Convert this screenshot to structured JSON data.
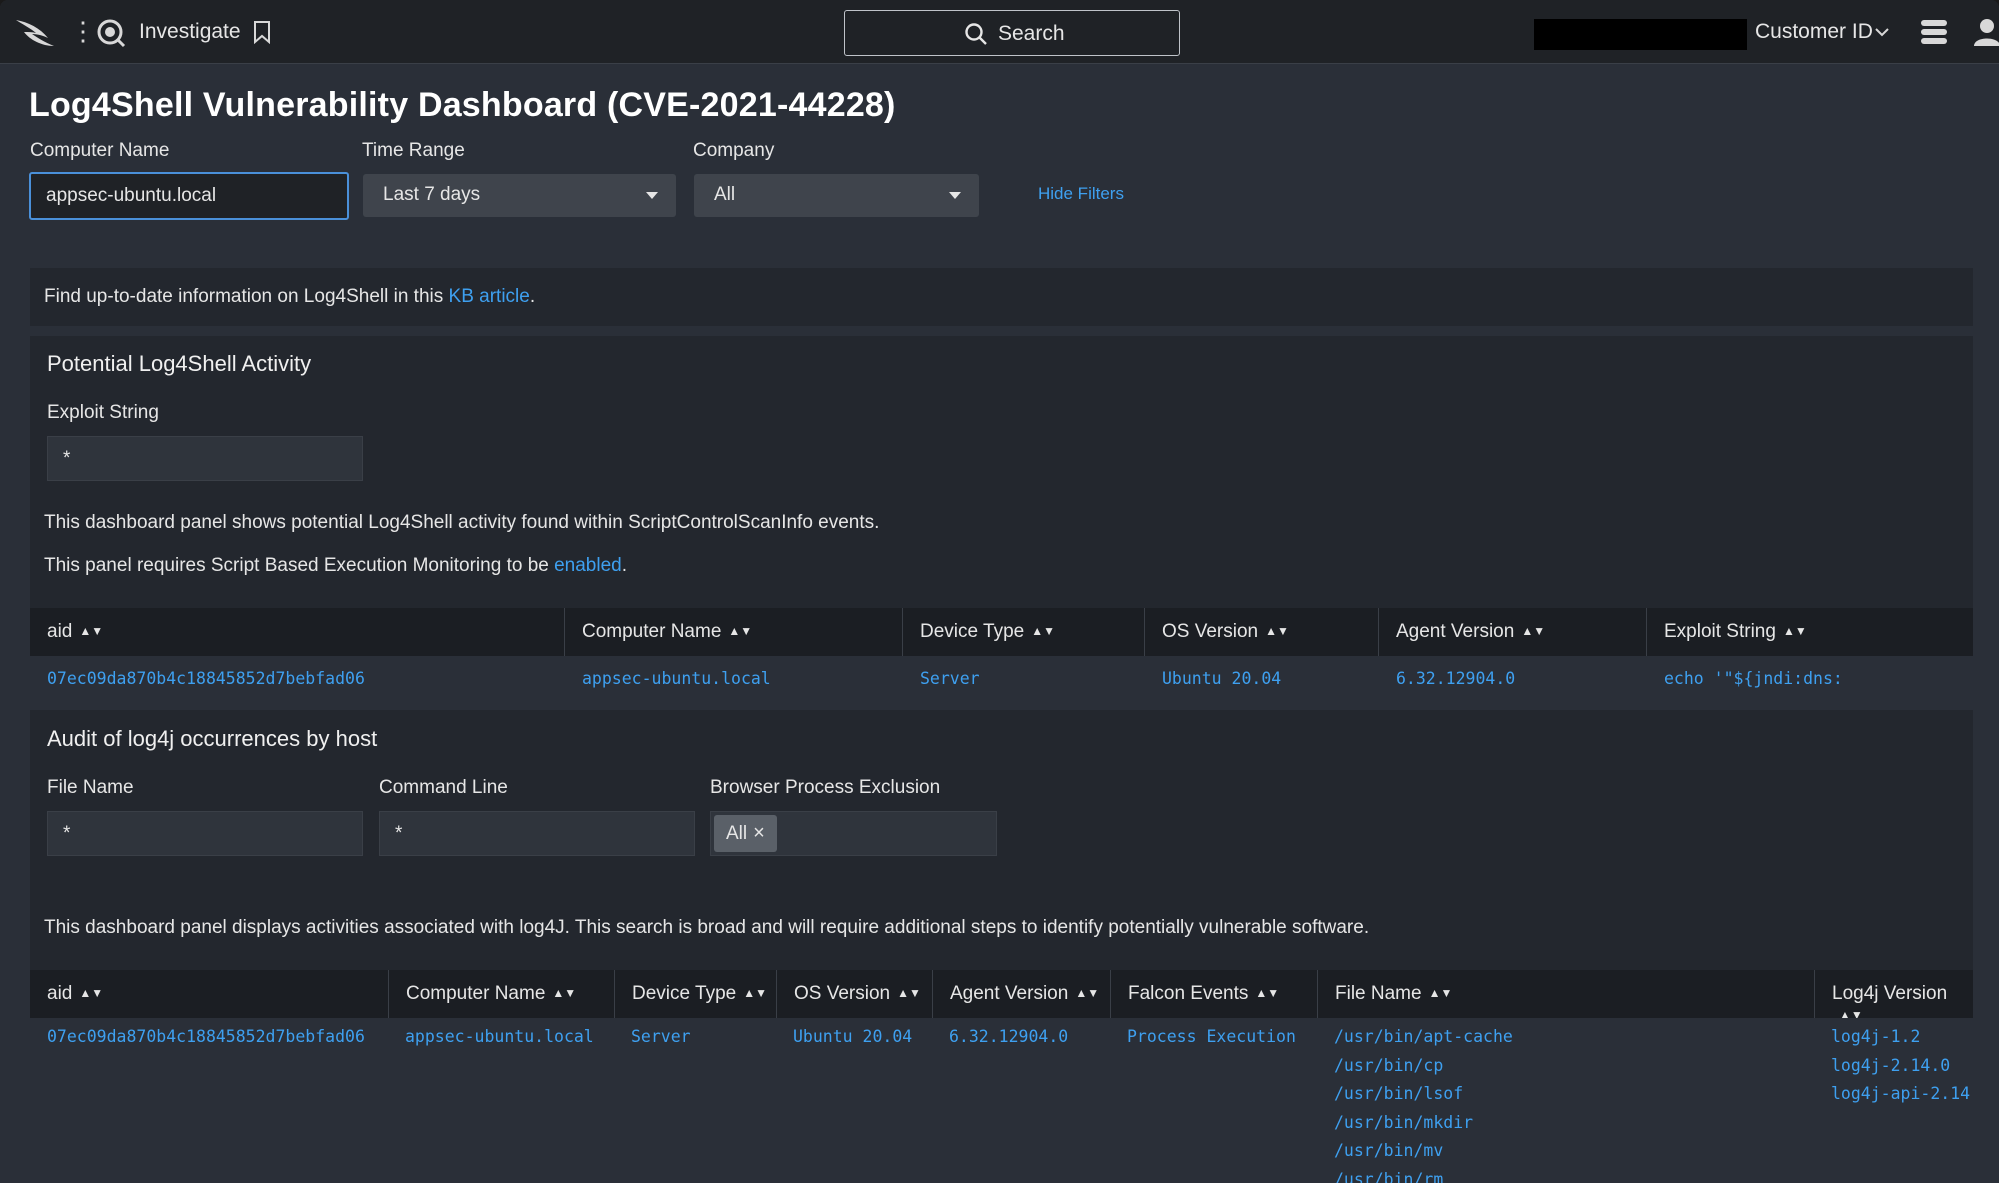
{
  "topbar": {
    "app_name": "Investigate",
    "search_label": "Search",
    "customer_id_label": "Customer ID"
  },
  "dashboard": {
    "title": "Log4Shell Vulnerability Dashboard (CVE-2021-44228)",
    "filters": {
      "computer_name_label": "Computer Name",
      "computer_name_value": "appsec-ubuntu.local",
      "time_range_label": "Time Range",
      "time_range_value": "Last 7 days",
      "company_label": "Company",
      "company_value": "All",
      "hide_filters": "Hide Filters"
    },
    "info": {
      "text_before": "Find up-to-date information on Log4Shell in this ",
      "link": "KB article",
      "text_after": "."
    },
    "activity_panel": {
      "title": "Potential Log4Shell Activity",
      "exploit_label": "Exploit String",
      "exploit_value": "*",
      "desc1": "This dashboard panel shows potential Log4Shell activity found within ScriptControlScanInfo events.",
      "desc2_before": "This panel requires Script Based Execution Monitoring to be ",
      "desc2_link": "enabled",
      "desc2_after": ".",
      "columns": [
        "aid",
        "Computer Name",
        "Device Type",
        "OS Version",
        "Agent Version",
        "Exploit String"
      ],
      "row": [
        "07ec09da870b4c18845852d7bebfad06",
        "appsec-ubuntu.local",
        "Server",
        "Ubuntu 20.04",
        "6.32.12904.0",
        "echo '\"${jndi:dns:"
      ]
    },
    "audit_panel": {
      "title": "Audit of log4j occurrences by host",
      "file_name_label": "File Name",
      "file_name_value": "*",
      "command_line_label": "Command Line",
      "command_line_value": "*",
      "browser_exclusion_label": "Browser Process Exclusion",
      "browser_exclusion_token": "All",
      "desc": "This dashboard panel displays activities associated with log4J. This search is broad and will require additional steps to identify potentially vulnerable software.",
      "columns": [
        "aid",
        "Computer Name",
        "Device Type",
        "OS Version",
        "Agent Version",
        "Falcon Events",
        "File Name",
        "Log4j Version"
      ],
      "row": {
        "aid": "07ec09da870b4c18845852d7bebfad06",
        "computer_name": "appsec-ubuntu.local",
        "device_type": "Server",
        "os_version": "Ubuntu 20.04",
        "agent_version": "6.32.12904.0",
        "falcon_events": "Process Execution",
        "file_names": [
          "/usr/bin/apt-cache",
          "/usr/bin/cp",
          "/usr/bin/lsof",
          "/usr/bin/mkdir",
          "/usr/bin/mv",
          "/usr/bin/rm"
        ],
        "log4j_versions": [
          "log4j-1.2",
          "log4j-2.14.0",
          "log4j-api-2.14"
        ]
      }
    }
  },
  "colors": {
    "accent_link": "#3ea0f0",
    "page_bg": "#2a2f38",
    "panel_bg": "#23272e",
    "topbar_bg": "#1f2226"
  }
}
